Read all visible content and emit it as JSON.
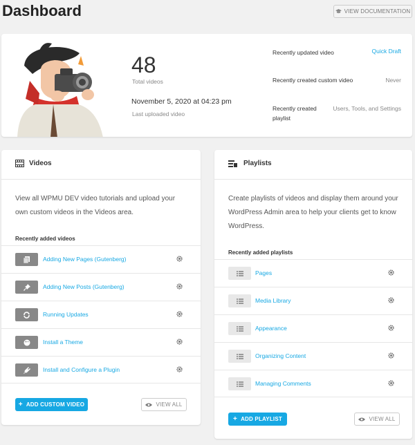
{
  "header": {
    "title": "Dashboard",
    "doc_button": "VIEW DOCUMENTATION"
  },
  "summary": {
    "total_count": "48",
    "total_label": "Total videos",
    "last_date": "November 5, 2020 at 04:23 pm",
    "last_label": "Last uploaded video",
    "rows": [
      {
        "label": "Recently updated video",
        "value": "Quick Draft"
      },
      {
        "label": "Recently created custom video",
        "value": "Never"
      },
      {
        "label": "Recently created playlist",
        "value": "Users, Tools, and Settings"
      }
    ]
  },
  "videos": {
    "title": "Videos",
    "description": "View all WPMU DEV video tutorials and upload your own custom videos in the Videos area.",
    "recent_label": "Recently added videos",
    "items": [
      {
        "label": "Adding New Pages (Gutenberg)",
        "icon": "pages-icon"
      },
      {
        "label": "Adding New Posts (Gutenberg)",
        "icon": "pin-icon"
      },
      {
        "label": "Running Updates",
        "icon": "refresh-icon"
      },
      {
        "label": "Install a Theme",
        "icon": "palette-icon"
      },
      {
        "label": "Install and Configure a Plugin",
        "icon": "plugin-icon"
      }
    ],
    "add_button": "ADD CUSTOM VIDEO",
    "view_all": "VIEW ALL"
  },
  "playlists": {
    "title": "Playlists",
    "description": "Create playlists of videos and display them around your WordPress Admin area to help your clients get to know WordPress.",
    "recent_label": "Recently added playlists",
    "items": [
      {
        "label": "Pages"
      },
      {
        "label": "Media Library"
      },
      {
        "label": "Appearance"
      },
      {
        "label": "Organizing Content"
      },
      {
        "label": "Managing Comments"
      }
    ],
    "add_button": "ADD PLAYLIST",
    "view_all": "VIEW ALL"
  },
  "colors": {
    "accent": "#17a8e3",
    "background": "#f1f1f1"
  }
}
